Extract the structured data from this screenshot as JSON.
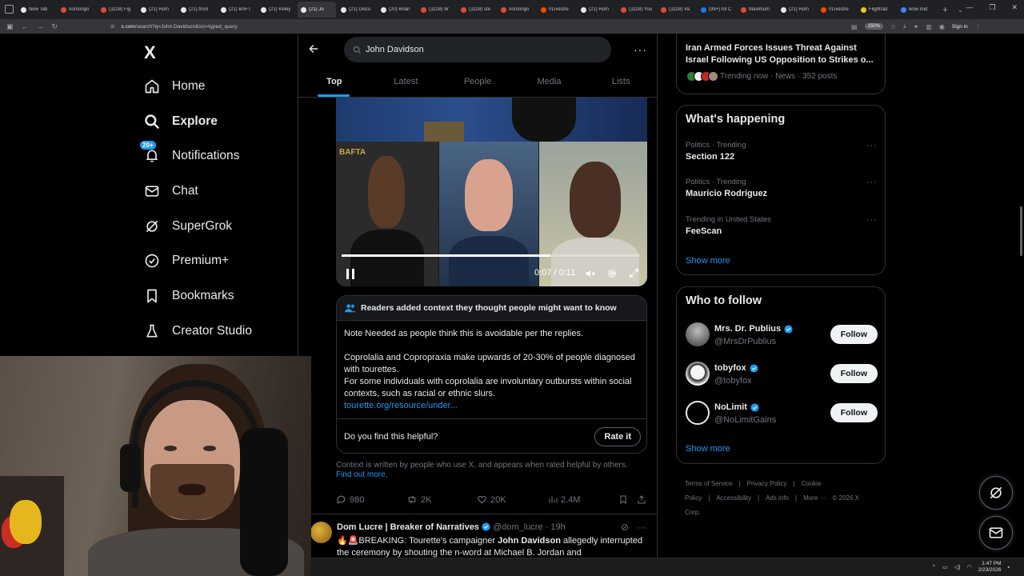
{
  "browser": {
    "tabs": [
      {
        "label": "New Tab",
        "color": "#e8eaed"
      },
      {
        "label": "Asmongo",
        "color": "#e24a3b"
      },
      {
        "label": "(3228) Fig",
        "color": "#e24a3b"
      },
      {
        "label": "(21) Hom",
        "color": "#e7e9ea"
      },
      {
        "label": "(21) trum",
        "color": "#e7e9ea"
      },
      {
        "label": "(21) BAFT",
        "color": "#e7e9ea"
      },
      {
        "label": "(21) Keley",
        "color": "#e7e9ea"
      },
      {
        "label": "(21) Jo",
        "color": "#e7e9ea"
      },
      {
        "label": "(21) Discu",
        "color": "#e7e9ea"
      },
      {
        "label": "(20) Brian",
        "color": "#e7e9ea"
      },
      {
        "label": "(3228) W",
        "color": "#e24a3b"
      },
      {
        "label": "(3228) ste",
        "color": "#e24a3b"
      },
      {
        "label": "Asmongo",
        "color": "#e24a3b"
      },
      {
        "label": "r/Livestre",
        "color": "#ff4500"
      },
      {
        "label": "(21) Hom",
        "color": "#e7e9ea"
      },
      {
        "label": "(3228) You",
        "color": "#e24a3b"
      },
      {
        "label": "(3228) Va",
        "color": "#e24a3b"
      },
      {
        "label": "(99+) All C",
        "color": "#1877f2"
      },
      {
        "label": "Maximum",
        "color": "#e24a3b"
      },
      {
        "label": "(21) Hom",
        "color": "#e7e9ea"
      },
      {
        "label": "r/Livestre",
        "color": "#ff4500"
      },
      {
        "label": "Flightrad",
        "color": "#f5c518"
      },
      {
        "label": "wow mid",
        "color": "#4285f4"
      }
    ],
    "active_tab_index": 7,
    "url_host": "x.com",
    "url_path": "/search?q=John Davidson&src=typed_query",
    "zoom": "150%",
    "signin": "Sign in"
  },
  "sidebar": {
    "logo": "X",
    "notif_badge": "20+",
    "items": [
      {
        "label": "Home",
        "icon": "home-icon"
      },
      {
        "label": "Explore",
        "icon": "search-icon"
      },
      {
        "label": "Notifications",
        "icon": "bell-icon"
      },
      {
        "label": "Chat",
        "icon": "mail-icon"
      },
      {
        "label": "SuperGrok",
        "icon": "grok-icon"
      },
      {
        "label": "Premium+",
        "icon": "verified-icon"
      },
      {
        "label": "Bookmarks",
        "icon": "bookmark-icon"
      },
      {
        "label": "Creator Studio",
        "icon": "flask-icon"
      }
    ]
  },
  "search": {
    "query": "John Davidson",
    "tabs": [
      "Top",
      "Latest",
      "People",
      "Media",
      "Lists"
    ]
  },
  "video": {
    "time": "0:07 / 0:11",
    "progress": 0.7,
    "watermark": "BAFTA"
  },
  "note": {
    "header": "Readers added context they thought people might want to know",
    "p1": "Note Needed as people think this is avoidable per the replies.",
    "p2a": "Coprolalia and Copropraxia make upwards of 20-30% of people diagnosed with tourettes.",
    "p2b": "For some individuals with coprolalia are involuntary outbursts within social contexts, such as racial or ethnic slurs.",
    "link": "tourette.org/resource/under...",
    "helpful_q": "Do you find this helpful?",
    "rate": "Rate it",
    "context": "Context is written by people who use X, and appears when rated helpful by others.",
    "find_out": "Find out more."
  },
  "actions": {
    "replies": "980",
    "reposts": "2K",
    "likes": "20K",
    "views": "2.4M"
  },
  "tweet2": {
    "name": "Dom Lucre | Breaker of Narratives",
    "handle": "@dom_lucre",
    "time": "· 19h",
    "text_pre": "🔥🚨BREAKING: Tourette's campaigner ",
    "text_bold": "John Davidson",
    "text_post": " allegedly interrupted the  ceremony by shouting the n-word at Michael B. Jordan and"
  },
  "right": {
    "top_trend": {
      "title": "Iran Armed Forces Issues Threat Against Israel Following US Opposition to Strikes o...",
      "meta": "Trending now · News · 352 posts"
    },
    "happening": {
      "title": "What's happening",
      "items": [
        {
          "category": "Politics · Trending",
          "name": "Section 122"
        },
        {
          "category": "Politics · Trending",
          "name": "Mauricio Rodríguez"
        },
        {
          "category": "Trending in United States",
          "name": "FeeScan"
        }
      ],
      "show_more": "Show more"
    },
    "who_to_follow": {
      "title": "Who to follow",
      "items": [
        {
          "name": "Mrs. Dr. Publius",
          "handle": "@MrsDrPublius",
          "button": "Follow"
        },
        {
          "name": "tobyfox",
          "handle": "@tobyfox",
          "button": "Follow"
        },
        {
          "name": "NoLimit",
          "handle": "@NoLimitGains",
          "button": "Follow"
        }
      ],
      "show_more": "Show more"
    },
    "footer": {
      "links": [
        "Terms of Service",
        "|",
        "Privacy Policy",
        "|",
        "Cookie Policy",
        "|",
        "Accessibility",
        "|",
        "Ads info",
        "|",
        "More ···",
        "© 2026 X Corp."
      ]
    }
  },
  "taskbar": {
    "time": "1:47 PM",
    "date": "2/23/2026"
  },
  "colors": {
    "accent": "#1d9bf0",
    "border": "#2f3336",
    "muted": "#71767b"
  }
}
